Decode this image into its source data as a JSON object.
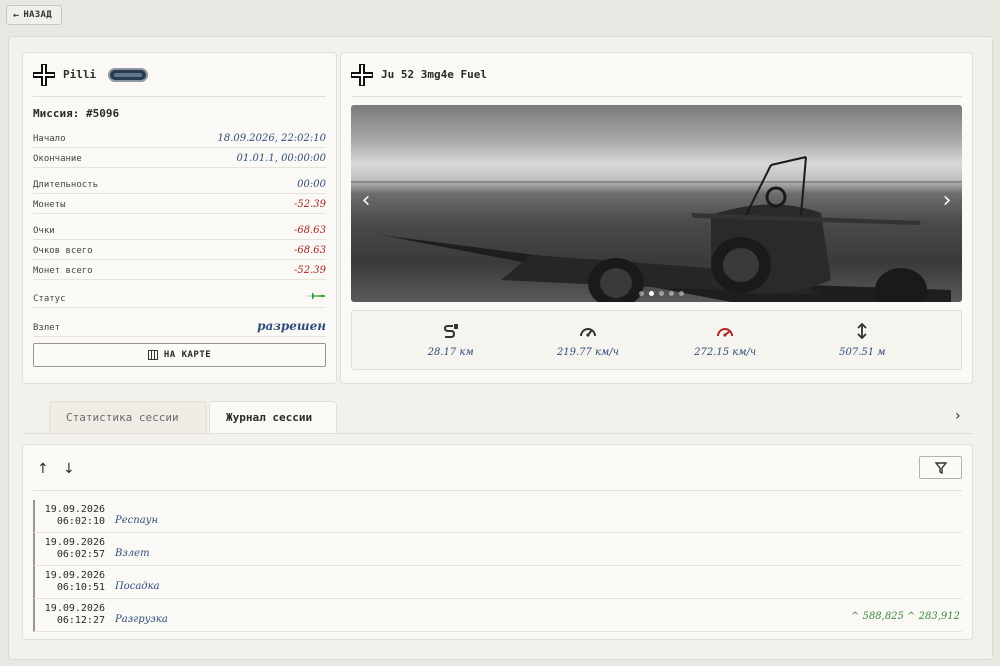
{
  "back": {
    "label": "НАЗАД"
  },
  "pilot": {
    "name": "Pilli",
    "mission": "Миссия: #5096",
    "rows": [
      {
        "label": "Начало",
        "value": "18.09.2026, 22:02:10"
      },
      {
        "label": "Окончание",
        "value": "01.01.1, 00:00:00"
      },
      {
        "label": "Длительность",
        "value": "00:00"
      },
      {
        "label": "Монеты",
        "value": "-52.39"
      },
      {
        "label": "Очки",
        "value": "-68.63"
      },
      {
        "label": "Очков всего",
        "value": "-68.63"
      },
      {
        "label": "Монет всего",
        "value": "-52.39"
      },
      {
        "label": "Статус",
        "value": ""
      },
      {
        "label": "Взлет",
        "value": "разрешен"
      }
    ],
    "map_button": "НА КАРТЕ"
  },
  "aircraft": {
    "name": "Ju 52 3mg4e Fuel",
    "stats": [
      {
        "icon": "distance-icon",
        "value": "28.17 км"
      },
      {
        "icon": "speedometer-icon",
        "value": "219.77 км/ч"
      },
      {
        "icon": "max-speed-icon",
        "value": "272.15 км/ч"
      },
      {
        "icon": "altitude-icon",
        "value": "507.51 м"
      }
    ]
  },
  "tabs": [
    {
      "label": "Статистика сессии"
    },
    {
      "label": "Журнал сессии"
    }
  ],
  "log": [
    {
      "date": "19.09.2026",
      "time": "06:02:10",
      "event": "Респаун",
      "extra": ""
    },
    {
      "date": "19.09.2026",
      "time": "06:02:57",
      "event": "Взлет",
      "extra": ""
    },
    {
      "date": "19.09.2026",
      "time": "06:10:51",
      "event": "Посадка",
      "extra": ""
    },
    {
      "date": "19.09.2026",
      "time": "06:12:27",
      "event": "Разгрузка",
      "extra": "^ 588,825 ^ 283,912"
    }
  ],
  "colors": {
    "value_blue": "#2f4d7a",
    "negative_red": "#a32222",
    "positive_green": "#3a8a3a",
    "status_green": "#3aa03a"
  }
}
